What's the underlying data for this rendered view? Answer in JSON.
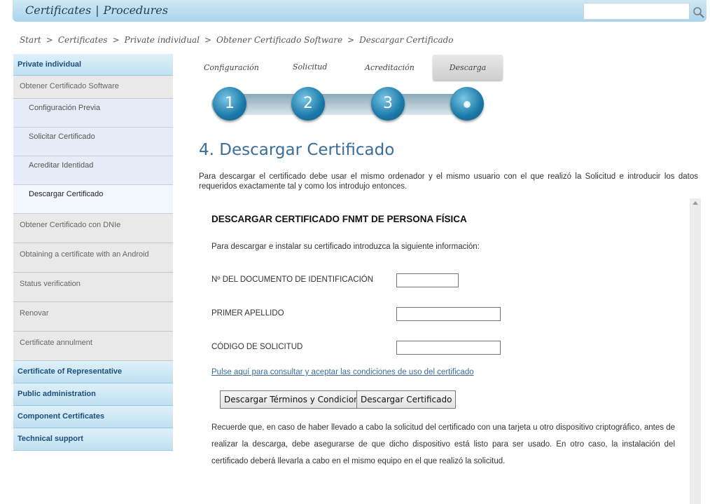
{
  "header": {
    "nav": [
      "Certificates",
      "Procedures"
    ],
    "separator": "|",
    "search_value": ""
  },
  "breadcrumb": [
    "Start",
    "Certificates",
    "Private individual",
    "Obtener Certificado Software",
    "Descargar Certificado"
  ],
  "sidebar": {
    "heading": "Private individual",
    "parent": "Obtener Certificado Software",
    "subitems": [
      "Configuración Previa",
      "Solicitar Certificado",
      "Acreditar Identidad",
      "Descargar Certificado"
    ],
    "items": [
      "Obtener Certificado con DNIe",
      "Obtaining a certificate with an Android",
      "Status verification",
      "Renovar",
      "Certificate annulment"
    ],
    "sections": [
      "Certificate of Representative",
      "Public administration",
      "Component Certificates",
      "Technical support"
    ]
  },
  "steps": {
    "labels": [
      "Configuración",
      "Solicitud",
      "Acreditación",
      "Descarga"
    ],
    "numbers": [
      "1",
      "2",
      "3"
    ],
    "active_index": 4
  },
  "page": {
    "title": "4. Descargar Certificado",
    "intro": "Para descargar el certificado debe usar el mismo ordenador y el mismo usuario con el que realizó la Solicitud e introducir los datos requeridos exactamente tal y como los introdujo entonces."
  },
  "form": {
    "title": "DESCARGAR CERTIFICADO FNMT DE PERSONA FÍSICA",
    "intro": "Para descargar e instalar su certificado introduzca la siguiente información:",
    "fields": [
      {
        "label": "Nº DEL DOCUMENTO DE IDENTIFICACIÓN",
        "value": ""
      },
      {
        "label": "PRIMER APELLIDO",
        "value": ""
      },
      {
        "label": "CÓDIGO DE SOLICITUD",
        "value": ""
      }
    ],
    "conditions_link": "Pulse aquí para consultar y aceptar las condiciones de uso del certificado",
    "btn_terms": "Descargar Términos y Condiciones",
    "btn_download": "Descargar Certificado",
    "note": "Recuerde que, en caso de haber llevado a cabo la solicitud del certificado con una tarjeta u otro dispositivo criptográfico, antes de realizar la descarga, debe asegurarse de que dicho dispositivo está listo para ser usado. En otro caso, la instalación del certificado deberá llevarla a cabo en el mismo equipo en el que realizó la solicitud."
  }
}
